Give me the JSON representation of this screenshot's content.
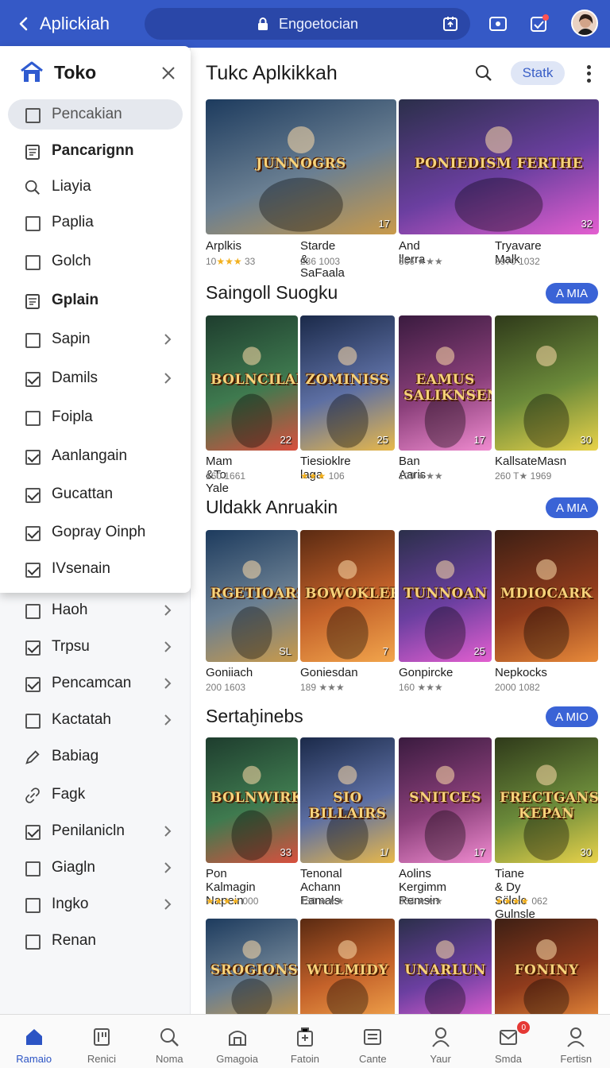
{
  "topbar": {
    "title": "Aplickiah",
    "url_text": "Engoetocian",
    "colors": {
      "bar": "#3559c6",
      "urlbar": "#2a47a8"
    },
    "icons": [
      "back-arrow-icon",
      "lock-icon",
      "share-icon",
      "tab-icon",
      "notification-icon"
    ]
  },
  "drawer": {
    "title": "Toko",
    "items": [
      {
        "label": "Pencakian",
        "icon": "checkbox",
        "checked": false,
        "selected": true,
        "bold": false,
        "chevron": false
      },
      {
        "label": "Pancarignn",
        "icon": "calendar-icon",
        "checked": false,
        "bold": true,
        "chevron": false
      },
      {
        "label": "Liayia",
        "icon": "search-icon",
        "checked": false,
        "bold": false,
        "chevron": false
      },
      {
        "label": "Paplia",
        "icon": "checkbox",
        "checked": false,
        "bold": false,
        "chevron": false
      },
      {
        "label": "Golch",
        "icon": "checkbox",
        "checked": false,
        "bold": false,
        "chevron": false
      },
      {
        "label": "Gplain",
        "icon": "calendar-icon",
        "checked": false,
        "bold": true,
        "chevron": false
      },
      {
        "label": "Sapin",
        "icon": "checkbox",
        "checked": false,
        "bold": false,
        "chevron": true
      },
      {
        "label": "Damils",
        "icon": "checkbox",
        "checked": true,
        "bold": false,
        "chevron": true
      },
      {
        "label": "Foipla",
        "icon": "checkbox",
        "checked": false,
        "bold": false,
        "chevron": false
      },
      {
        "label": "Aanlangain",
        "icon": "checkbox",
        "checked": true,
        "bold": false,
        "chevron": false
      },
      {
        "label": "Gucattan",
        "icon": "checkbox",
        "checked": true,
        "bold": false,
        "chevron": false
      },
      {
        "label": "Gopray Oinph",
        "icon": "checkbox",
        "checked": true,
        "bold": false,
        "chevron": false
      },
      {
        "label": "IVsenain",
        "icon": "checkbox",
        "checked": true,
        "bold": false,
        "chevron": false
      }
    ]
  },
  "sidebar_under": {
    "items": [
      {
        "label": "Haoh",
        "icon": "checkbox",
        "checked": false,
        "chevron": true
      },
      {
        "label": "Trpsu",
        "icon": "checkbox",
        "checked": true,
        "chevron": true
      },
      {
        "label": "Pencamcan",
        "icon": "checkbox",
        "checked": true,
        "chevron": true
      },
      {
        "label": "Kactatah",
        "icon": "checkbox",
        "checked": false,
        "chevron": true
      },
      {
        "label": "Babiag",
        "icon": "pen-icon",
        "checked": false,
        "chevron": false
      },
      {
        "label": "Fagk",
        "icon": "link-icon",
        "checked": false,
        "chevron": false
      },
      {
        "label": "Penilanicln",
        "icon": "checkbox",
        "checked": true,
        "chevron": true
      },
      {
        "label": "Giagln",
        "icon": "checkbox",
        "checked": false,
        "chevron": true
      },
      {
        "label": "Ingko",
        "icon": "checkbox",
        "checked": false,
        "chevron": true
      },
      {
        "label": "Renan",
        "icon": "checkbox",
        "checked": false,
        "chevron": false
      }
    ]
  },
  "main": {
    "title": "Tukc Aplkikkah",
    "stat_chip": "Statk",
    "sections": [
      {
        "title": "",
        "more": "",
        "cards": [
          {
            "art": "JUNNOGRS",
            "num": "17",
            "name": "Arplkis",
            "meta": "10",
            "stars": "★★★",
            "meta2": "33"
          },
          {
            "art": "",
            "num": "",
            "name": "Starde & SaFaala",
            "meta": "236",
            "stars": "",
            "meta2": "1003"
          },
          {
            "art": "PONIEDISM FERTHE",
            "num": "32",
            "name": "And llerra",
            "meta": "366",
            "stars": "",
            "meta2": "★★★"
          },
          {
            "art": "",
            "num": "",
            "name": "Tryavare Malk",
            "meta": "3970",
            "stars": "",
            "meta2": "1032"
          }
        ]
      },
      {
        "title": "Saingoll Suogku",
        "more": "A MIA",
        "cards": [
          {
            "art": "BOLNCILAN",
            "num": "22",
            "name": "Mam &To Yale",
            "meta": "160",
            "stars": "",
            "meta2": "1661"
          },
          {
            "art": "ZOMINISS",
            "num": "25",
            "name": "Tiesioklre laga",
            "meta": "",
            "stars": "★★★",
            "meta2": "106"
          },
          {
            "art": "EAMUS SALIKNSEN",
            "num": "17",
            "name": "Ban Aaris",
            "meta": "109",
            "stars": "",
            "meta2": "★★★"
          },
          {
            "art": "",
            "num": "30",
            "name": "KallsateMasn",
            "meta": "260",
            "stars": "",
            "meta2": "T★ 1969"
          }
        ]
      },
      {
        "title": "Uldakk Anruakin",
        "more": "A MIA",
        "cards": [
          {
            "art": "RGETIOARS",
            "num": "SL",
            "name": "Goniiach",
            "meta": "200",
            "stars": "",
            "meta2": "1603"
          },
          {
            "art": "BOWOKLER",
            "num": "7",
            "name": "Goniesdan",
            "meta": "189",
            "stars": "",
            "meta2": "★★★"
          },
          {
            "art": "TUNNOAN",
            "num": "25",
            "name": "Gonpircke",
            "meta": "160",
            "stars": "",
            "meta2": "★★★"
          },
          {
            "art": "MDIOCARK",
            "num": "",
            "name": "Nepkocks",
            "meta": "2000",
            "stars": "",
            "meta2": "1082"
          }
        ]
      },
      {
        "title": "Sertaḫinebs",
        "more": "A MIO",
        "cards": [
          {
            "art": "BOLNWIRK",
            "num": "33",
            "name": "Pon Kalmagin Napein",
            "meta": "",
            "stars": "★★★★",
            "meta2": "000"
          },
          {
            "art": "SIO BILLAIRS",
            "num": "1/",
            "name": "Tenonal Achann Eamals",
            "meta": "130",
            "stars": "",
            "meta2": "★★★"
          },
          {
            "art": "SNITCES",
            "num": "17",
            "name": "Aolins Kergimm Remsin",
            "meta": "334",
            "stars": "",
            "meta2": "★★★"
          },
          {
            "art": "FRECTGANS KEPAN",
            "num": "30",
            "name": "Tiane & Dy Sc̈lelc Gulnsle",
            "meta": "",
            "stars": "★★★★",
            "meta2": "062"
          }
        ]
      },
      {
        "title": "",
        "more": "",
        "cards": [
          {
            "art": "SROGIONSA",
            "num": "",
            "name": "",
            "meta": "",
            "stars": "",
            "meta2": ""
          },
          {
            "art": "WULMIDY",
            "num": "",
            "name": "",
            "meta": "",
            "stars": "",
            "meta2": ""
          },
          {
            "art": "UNARLUN",
            "num": "",
            "name": "",
            "meta": "",
            "stars": "",
            "meta2": ""
          },
          {
            "art": "FONINY",
            "num": "",
            "name": "",
            "meta": "",
            "stars": "",
            "meta2": ""
          }
        ]
      }
    ]
  },
  "bottomnav": {
    "items": [
      {
        "label": "Ramaio",
        "icon": "home-icon",
        "active": true
      },
      {
        "label": "Renici",
        "icon": "apps-icon",
        "active": false
      },
      {
        "label": "Noma",
        "icon": "search-icon",
        "active": false
      },
      {
        "label": "Gmagoia",
        "icon": "store-icon",
        "active": false
      },
      {
        "label": "Fatoin",
        "icon": "briefcase-icon",
        "active": false
      },
      {
        "label": "Cante",
        "icon": "list-icon",
        "active": false
      },
      {
        "label": "Yaur",
        "icon": "person-icon",
        "active": false
      },
      {
        "label": "Smda",
        "icon": "mail-icon",
        "active": false,
        "badge": "0"
      },
      {
        "label": "Fertisn",
        "icon": "account-icon",
        "active": false
      }
    ]
  }
}
